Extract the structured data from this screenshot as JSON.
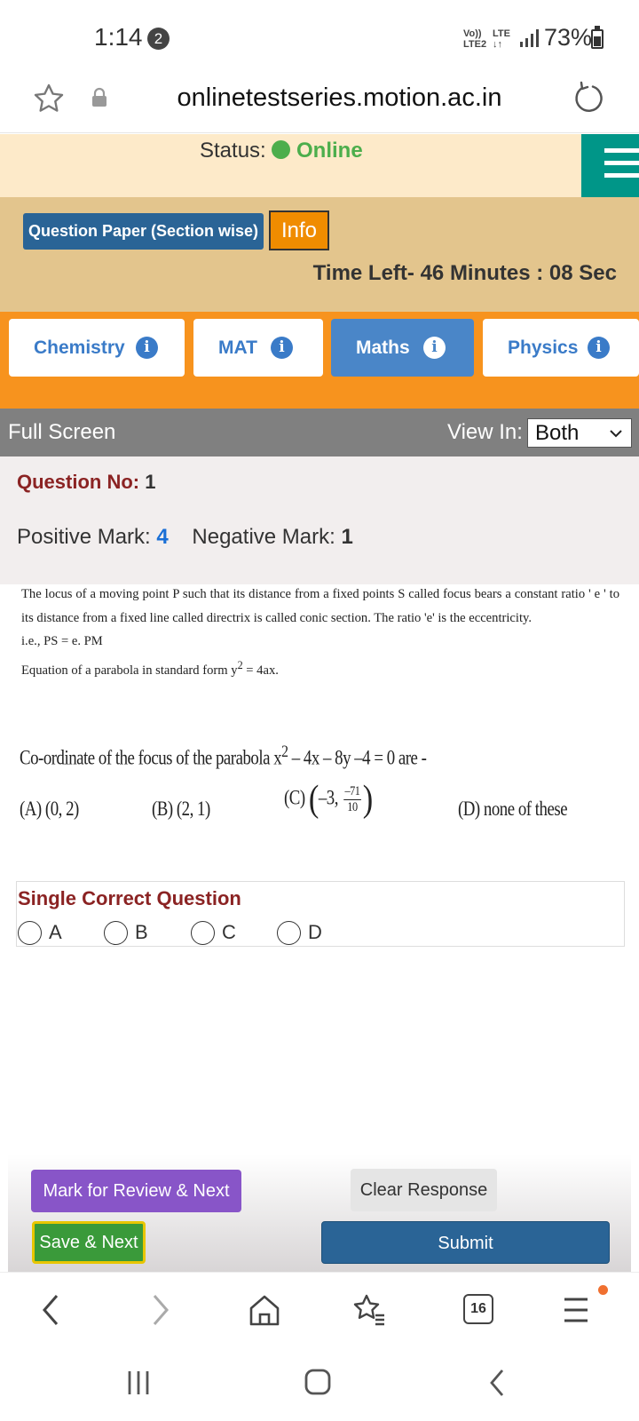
{
  "status_bar": {
    "time": "1:14",
    "notification_count": "2",
    "network_volte": "Vo)) LTE2",
    "network_lte": "LTE",
    "battery": "73%"
  },
  "browser": {
    "url": "onlinetestseries.motion.ac.in",
    "tab_count": "16"
  },
  "status": {
    "label": "Status:",
    "value": "Online",
    "online_color": "#4cae4c"
  },
  "header": {
    "question_paper_button": "Question Paper (Section wise)",
    "info_button": "Info",
    "time_left": "Time Left- 46 Minutes : 08 Sec"
  },
  "tabs": [
    {
      "label": "Chemistry",
      "active": false
    },
    {
      "label": "MAT",
      "active": false
    },
    {
      "label": "Maths",
      "active": true
    },
    {
      "label": "Physics",
      "active": false
    }
  ],
  "toolbar": {
    "full_screen": "Full Screen",
    "view_in_label": "View In:",
    "view_in_value": "Both"
  },
  "question": {
    "number_label": "Question No:",
    "number": "1",
    "positive_label": "Positive Mark:",
    "positive_value": "4",
    "negative_label": "Negative Mark:",
    "negative_value": "1",
    "passage_1": "The locus of a moving point P such that its distance from a fixed points S called focus bears a constant ratio ' e ' to its distance from a fixed line called directrix is called conic section. The ratio 'e' is the eccentricity.",
    "passage_2": "i.e., PS = e. PM",
    "passage_3_a": "Equation of a parabola in standard form y",
    "passage_3_sup": "2",
    "passage_3_b": " = 4ax.",
    "text_a": "Co-ordinate of the focus of the parabola x",
    "text_sup": "2",
    "text_b": " – 4x – 8y –4 = 0 are -",
    "options": {
      "a": "(A) (0, 2)",
      "b": "(B) (2, 1)",
      "c_prefix": "(C)",
      "c_open": "(",
      "c_inner": "–3,",
      "c_num": "–71",
      "c_den": "10",
      "c_close": ")",
      "d": "(D) none of these"
    }
  },
  "answer": {
    "type_label": "Single Correct Question",
    "choices": [
      "A",
      "B",
      "C",
      "D"
    ]
  },
  "actions": {
    "mark_review": "Mark for Review & Next",
    "clear_response": "Clear Response",
    "save_next": "Save & Next",
    "submit": "Submit"
  },
  "colors": {
    "accent_orange": "#f7931e",
    "header_tan": "#e3c58d",
    "primary_blue": "#2a6496",
    "active_tab": "#4a86c8",
    "review_purple": "#8855c8",
    "save_green": "#3a9a3a",
    "question_red": "#8b2323"
  }
}
